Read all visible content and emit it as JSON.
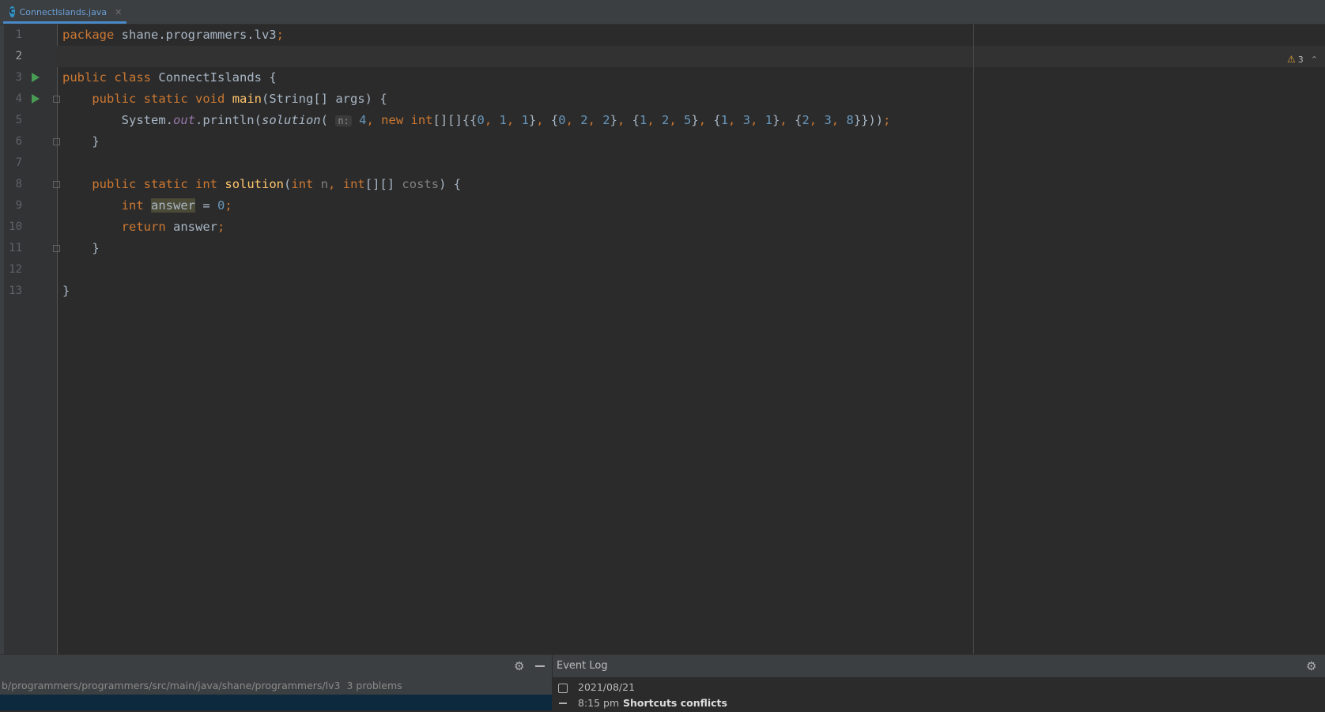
{
  "tab": {
    "icon": "java-class-icon",
    "label": "ConnectIslands.java"
  },
  "editor": {
    "warnings_count": "3",
    "lines": [
      {
        "n": "1"
      },
      {
        "n": "2"
      },
      {
        "n": "3"
      },
      {
        "n": "4"
      },
      {
        "n": "5"
      },
      {
        "n": "6"
      },
      {
        "n": "7"
      },
      {
        "n": "8"
      },
      {
        "n": "9"
      },
      {
        "n": "10"
      },
      {
        "n": "11"
      },
      {
        "n": "12"
      },
      {
        "n": "13"
      }
    ],
    "code": {
      "l1": {
        "kw": "package",
        "rest": "shane.programmers.lv3",
        "semi": ";"
      },
      "l3": {
        "kw1": "public",
        "kw2": "class",
        "name": "ConnectIslands",
        "brace": "{"
      },
      "l4": {
        "kw1": "public",
        "kw2": "static",
        "kw3": "void",
        "fn": "main",
        "sig": "(String[] args) {"
      },
      "l5": {
        "pre": "System.",
        "field": "out",
        "call": ".println(",
        "fn": "solution",
        "open": "(",
        "hint": "n:",
        "n4": "4",
        "c1": ",",
        "kwnew": "new",
        "kwint": "int",
        "arr": "[][]{{",
        "a1": "0",
        "a2": "1",
        "a3": "1",
        "b1": "0",
        "b2": "2",
        "b3": "2",
        "d1": "1",
        "d2": "2",
        "d3": "5",
        "e1": "1",
        "e2": "3",
        "e3": "1",
        "f1": "2",
        "f2": "3",
        "f3": "8",
        "close": "}}));"
      },
      "l6": {
        "brace": "}"
      },
      "l8": {
        "kw1": "public",
        "kw2": "static",
        "kw3": "int",
        "fn": "solution",
        "p1kw": "int",
        "p1": "n",
        "p2kw": "int",
        "p2arr": "[][]",
        "p2": "costs",
        "tail": ") {"
      },
      "l9": {
        "kw": "int",
        "var": "answer",
        "eq": " = ",
        "num": "0",
        "semi": ";"
      },
      "l10": {
        "kw": "return",
        "var": "answer",
        "semi": ";"
      },
      "l11": {
        "brace": "}"
      },
      "l13": {
        "brace": "}"
      }
    }
  },
  "problems": {
    "path": "b/programmers/programmers/src/main/java/shane/programmers/lv3",
    "count": "3 problems"
  },
  "event_log": {
    "title": "Event Log",
    "date": "2021/08/21",
    "time": "8:15 pm",
    "message": "Shortcuts conflicts"
  },
  "colors": {
    "keyword": "#cc7832",
    "function": "#ffc66d",
    "number": "#6897bb",
    "text": "#a9b7c6",
    "background": "#2b2b2b"
  }
}
